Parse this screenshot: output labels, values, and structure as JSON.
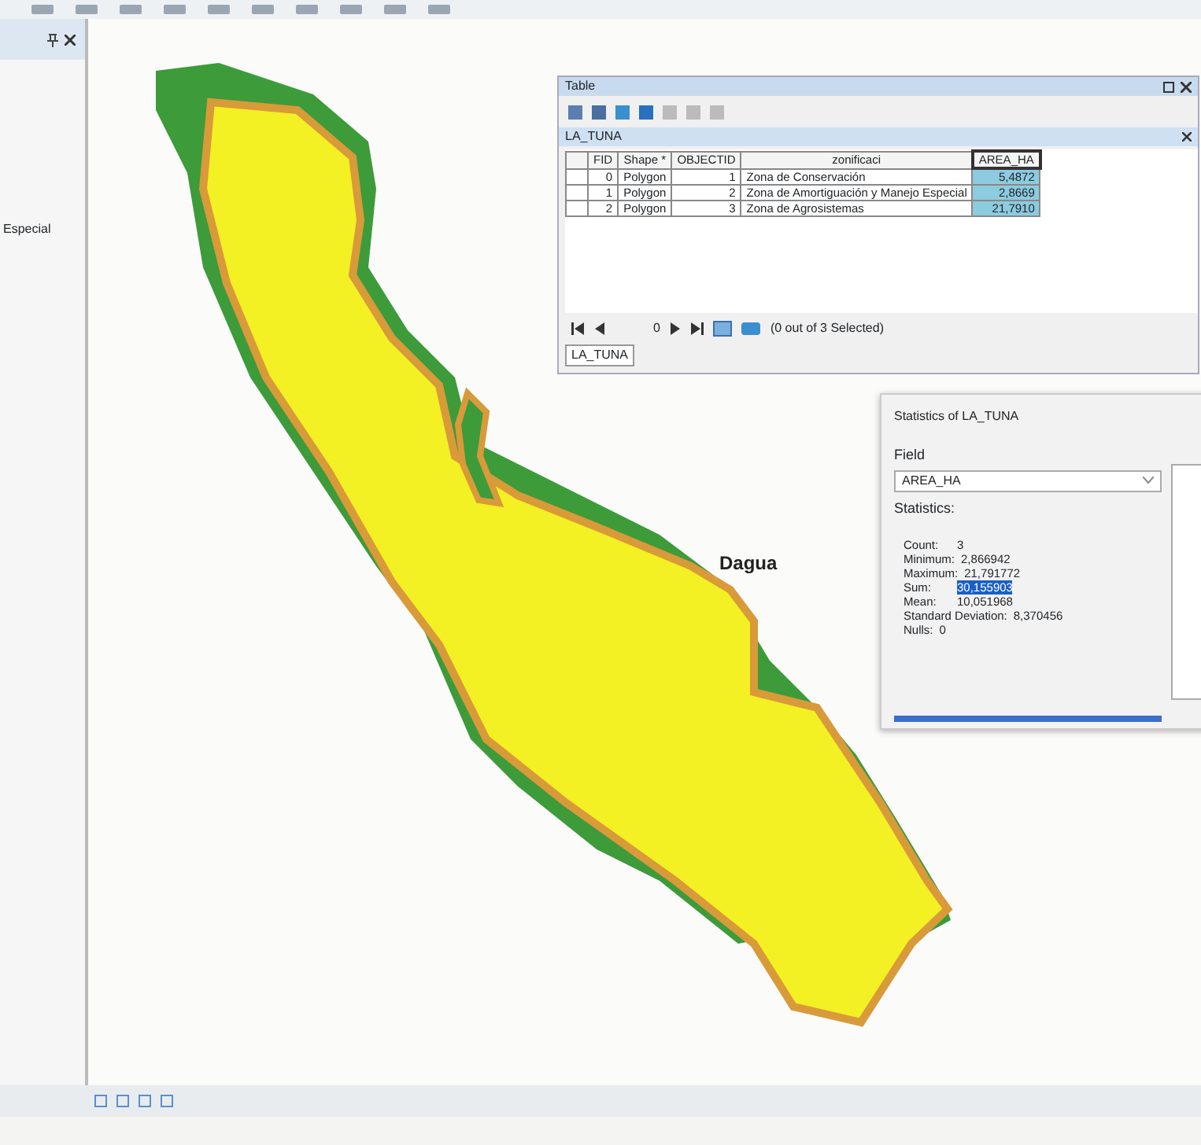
{
  "left_panel": {
    "label": "Especial"
  },
  "map": {
    "place_label": "Dagua"
  },
  "table_window": {
    "title": "Table",
    "tab_title": "LA_TUNA",
    "columns": [
      {
        "label": "FID",
        "selected": false
      },
      {
        "label": "Shape *",
        "selected": false
      },
      {
        "label": "OBJECTID",
        "selected": false
      },
      {
        "label": "zonificaci",
        "selected": false
      },
      {
        "label": "AREA_HA",
        "selected": true
      }
    ],
    "rows": [
      [
        "0",
        "Polygon",
        "1",
        "Zona de Conservación",
        "5,4872"
      ],
      [
        "1",
        "Polygon",
        "2",
        "Zona de Amortiguación y Manejo Especial",
        "2,8669"
      ],
      [
        "2",
        "Polygon",
        "3",
        "Zona de Agrosistemas",
        "21,7910"
      ]
    ],
    "record": "0",
    "selection_status": "(0 out of 3 Selected)",
    "bottom_tab": "LA_TUNA"
  },
  "statistics_window": {
    "title": "Statistics of LA_TUNA",
    "field_label": "Field",
    "field_value": "AREA_HA",
    "stats_label": "Statistics:",
    "stats": [
      {
        "label": "Count:",
        "value": "3",
        "selected": false
      },
      {
        "label": "Minimum:",
        "value": "2,866942",
        "selected": false
      },
      {
        "label": "Maximum:",
        "value": "21,791772",
        "selected": false
      },
      {
        "label": "Sum:",
        "value": "30,155903",
        "selected": true
      },
      {
        "label": "Mean:",
        "value": "10,051968",
        "selected": false
      },
      {
        "label": "Standard Deviation:",
        "value": "8,370456",
        "selected": false
      },
      {
        "label": "Nulls:",
        "value": "0",
        "selected": false
      }
    ]
  }
}
